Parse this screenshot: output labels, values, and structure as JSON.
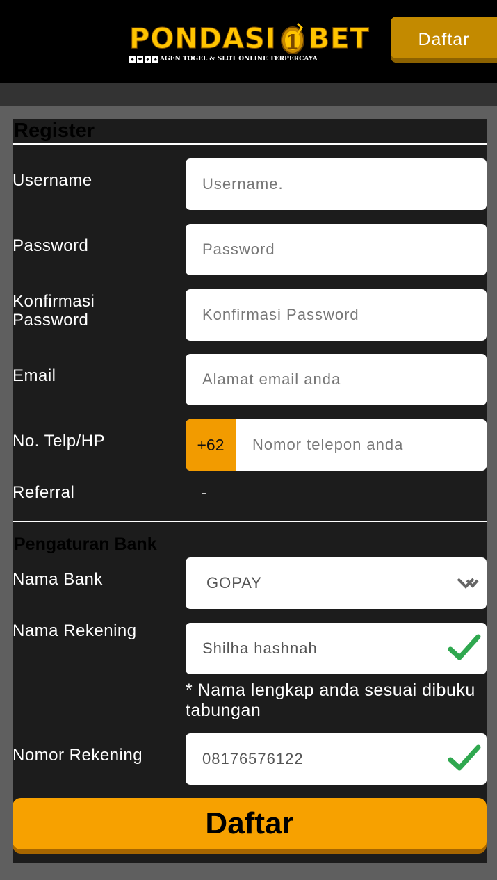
{
  "header": {
    "logo_text_left": "PONDASI",
    "logo_text_right": "BET",
    "logo_tagline": "AGEN TOGEL & SLOT ONLINE TERPERCAYA",
    "register_button": "Daftar"
  },
  "form": {
    "title": "Register",
    "username": {
      "label": "Username",
      "placeholder": "Username."
    },
    "password": {
      "label": "Password",
      "placeholder": "Password"
    },
    "confirm_password": {
      "label": "Konfirmasi Password",
      "placeholder": "Konfirmasi Password"
    },
    "email": {
      "label": "Email",
      "placeholder": "Alamat email anda"
    },
    "phone": {
      "label": "No. Telp/HP",
      "prefix": "+62",
      "placeholder": "Nomor telepon anda"
    },
    "referral": {
      "label": "Referral",
      "value": "-"
    },
    "bank_section_title": "Pengaturan Bank",
    "bank_name": {
      "label": "Nama Bank",
      "value": "GOPAY"
    },
    "account_name": {
      "label": "Nama Rekening",
      "value": "Shilha hashnah",
      "hint": "* Nama lengkap anda sesuai dibuku tabungan"
    },
    "account_number": {
      "label": "Nomor Rekening",
      "value": "08176576122"
    },
    "submit_button": "Daftar"
  },
  "colors": {
    "accent": "#f7a100",
    "header_button": "#c38a00",
    "valid_check": "#2fa84f",
    "panel": "#1c1c1c"
  }
}
